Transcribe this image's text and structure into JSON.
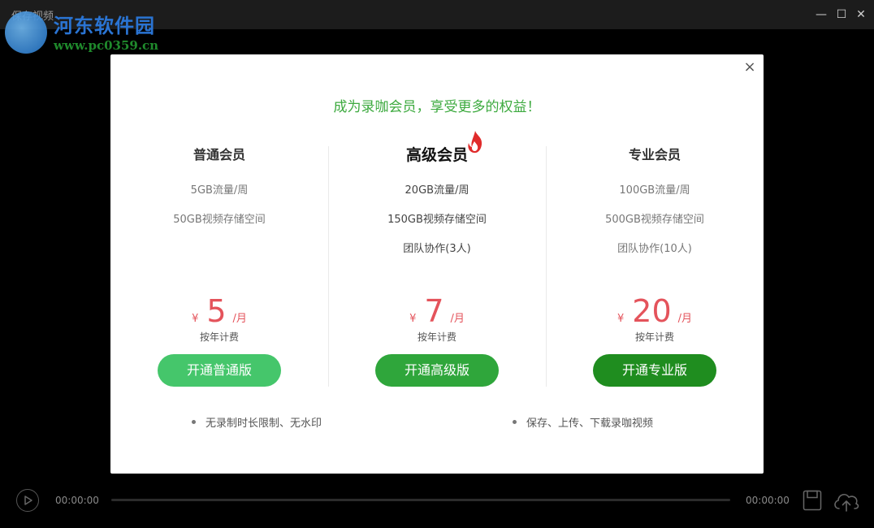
{
  "window": {
    "title": "保存视频",
    "controls": {
      "minimize": "—",
      "maximize": "☐",
      "close": "✕"
    }
  },
  "watermark": {
    "site_name": "河东软件园",
    "url": "www.pc0359.cn"
  },
  "modal": {
    "close": "×",
    "headline": "成为录咖会员，享受更多的权益！",
    "plans": [
      {
        "name": "普通会员",
        "features": [
          "5GB流量/周",
          "50GB视频存储空间"
        ],
        "currency": "¥",
        "price": "5",
        "per": "/月",
        "billing": "按年计费",
        "cta": "开通普通版"
      },
      {
        "name": "高级会员",
        "features": [
          "20GB流量/周",
          "150GB视频存储空间",
          "团队协作(3人)"
        ],
        "currency": "¥",
        "price": "7",
        "per": "/月",
        "billing": "按年计费",
        "cta": "开通高级版",
        "badge_icon": "flame-icon"
      },
      {
        "name": "专业会员",
        "features": [
          "100GB流量/周",
          "500GB视频存储空间",
          "团队协作(10人)"
        ],
        "currency": "¥",
        "price": "20",
        "per": "/月",
        "billing": "按年计费",
        "cta": "开通专业版"
      }
    ],
    "notes": [
      "无录制时长限制、无水印",
      "保存、上传、下载录咖视频"
    ]
  },
  "player": {
    "current_time": "00:00:00",
    "total_time": "00:00:00",
    "progress": 0
  },
  "colors": {
    "headline": "#3daa3f",
    "price": "#e4535b",
    "cta_basic": "#45c66b",
    "cta_premium": "#2fa63b",
    "cta_pro": "#1f8d1f"
  }
}
